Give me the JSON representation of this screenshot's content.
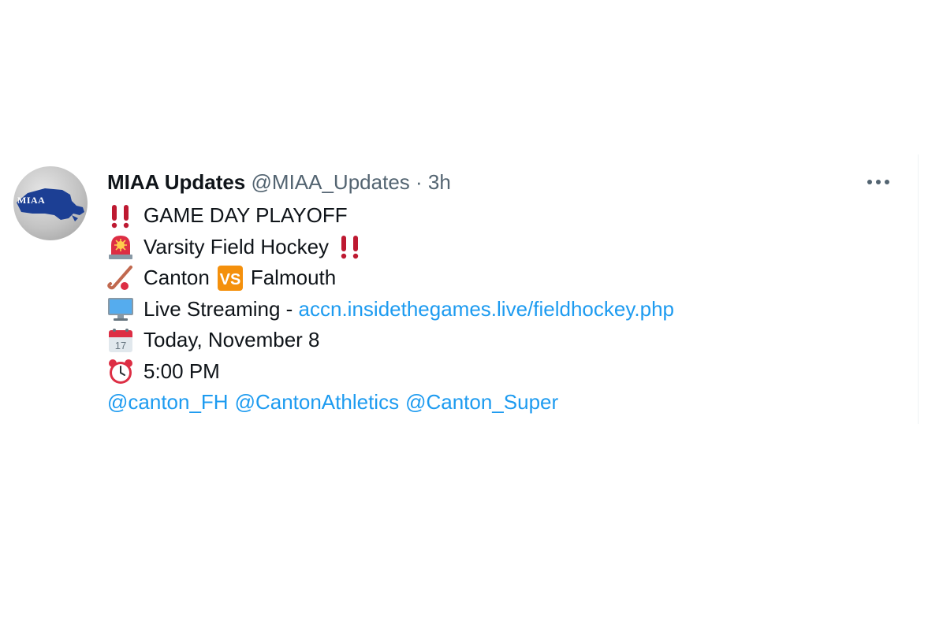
{
  "tweet": {
    "author": {
      "name": "MIAA Updates",
      "handle": "@MIAA_Updates",
      "separator": "·",
      "time": "3h",
      "avatar_text": "MIAA"
    },
    "more_icon": "more-horizontal-icon",
    "lines": {
      "line1": {
        "icon": "double-exclamation-icon",
        "text": "GAME DAY PLAYOFF"
      },
      "line2": {
        "icon": "police-light-icon",
        "text": "Varsity Field Hockey",
        "trailing_icon": "double-exclamation-icon"
      },
      "line3": {
        "icon": "field-hockey-icon",
        "team1": "Canton",
        "vs_icon": "vs-icon",
        "team2": "Falmouth"
      },
      "line4": {
        "icon": "desktop-computer-icon",
        "text": "Live Streaming - ",
        "link": "accn.insidethegames.live/fieldhockey.php"
      },
      "line5": {
        "icon": "calendar-icon",
        "text": "Today, November 8"
      },
      "line6": {
        "icon": "alarm-clock-icon",
        "text": "5:00 PM"
      }
    },
    "mentions": [
      "@canton_FH",
      "@CantonAthletics",
      "@Canton_Super"
    ]
  },
  "colors": {
    "link": "#1d9bf0",
    "secondary_text": "#536471",
    "primary_text": "#0f1419",
    "exclamation_red": "#be1931",
    "vs_orange": "#f4900c"
  }
}
